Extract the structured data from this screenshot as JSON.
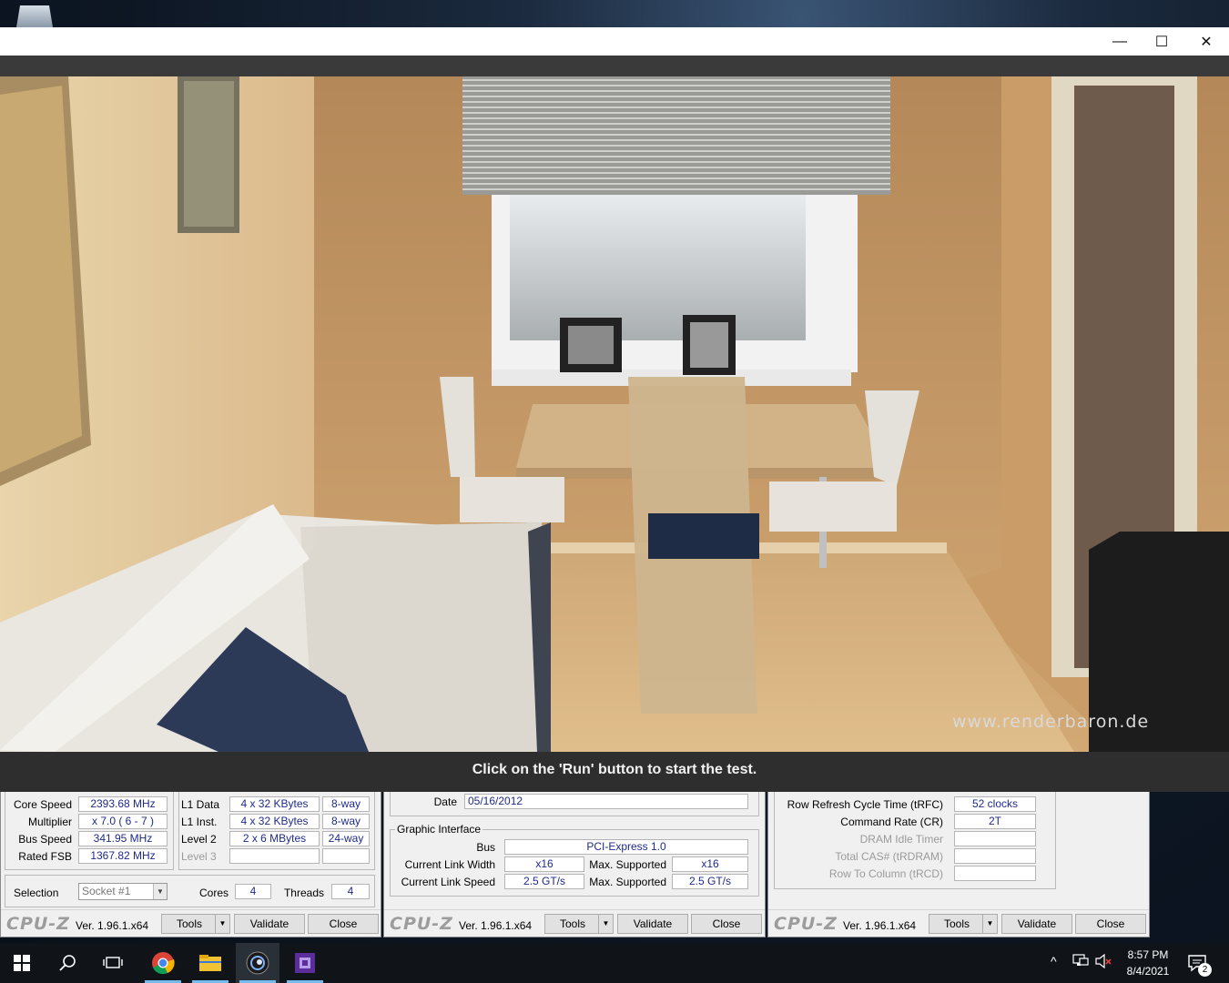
{
  "viewer": {
    "status_message": "Click on the 'Run' button to start the test.",
    "watermark": "www.renderbaron.de",
    "window_buttons": {
      "minimize": "—",
      "maximize": "☐",
      "close": "✕"
    }
  },
  "cpuz_cpu": {
    "core_speed_label": "Core Speed",
    "core_speed": "2393.68 MHz",
    "multiplier_label": "Multiplier",
    "multiplier": "x 7.0 ( 6 - 7 )",
    "bus_speed_label": "Bus Speed",
    "bus_speed": "341.95 MHz",
    "rated_fsb_label": "Rated FSB",
    "rated_fsb": "1367.82 MHz",
    "l1_data_label": "L1 Data",
    "l1_data": "4 x 32 KBytes",
    "l1_data_way": "8-way",
    "l1_inst_label": "L1 Inst.",
    "l1_inst": "4 x 32 KBytes",
    "l1_inst_way": "8-way",
    "level2_label": "Level 2",
    "level2": "2 x 6 MBytes",
    "level2_way": "24-way",
    "level3_label": "Level 3",
    "selection_label": "Selection",
    "selection": "Socket #1",
    "cores_label": "Cores",
    "cores": "4",
    "threads_label": "Threads",
    "threads": "4"
  },
  "cpuz_mainboard": {
    "date_label": "Date",
    "date": "05/16/2012",
    "graphic_interface_label": "Graphic Interface",
    "bus_label": "Bus",
    "bus": "PCI-Express 1.0",
    "link_width_label": "Current Link Width",
    "link_width": "x16",
    "link_width_max_label": "Max. Supported",
    "link_width_max": "x16",
    "link_speed_label": "Current Link Speed",
    "link_speed": "2.5 GT/s",
    "link_speed_max_label": "Max. Supported",
    "link_speed_max": "2.5 GT/s"
  },
  "cpuz_memory": {
    "trfc_label": "Row Refresh Cycle Time (tRFC)",
    "trfc": "52 clocks",
    "cr_label": "Command Rate (CR)",
    "cr": "2T",
    "idle_label": "DRAM Idle Timer",
    "trdram_label": "Total CAS# (tRDRAM)",
    "trcd_label": "Row To Column (tRCD)"
  },
  "cpuz_footer": {
    "logo": "CPU-Z",
    "version": "Ver. 1.96.1.x64",
    "tools": "Tools",
    "validate": "Validate",
    "close": "Close",
    "dropdown_arrow": "▼"
  },
  "taskbar": {
    "time": "8:57 PM",
    "date": "8/4/2021",
    "notification_count": "2",
    "icons": [
      "windows-start-icon",
      "search-icon",
      "task-view-icon",
      "chrome-icon",
      "file-explorer-icon",
      "benchmark-app-icon",
      "cpuz-app-icon"
    ]
  },
  "colors": {
    "cpuz_value": "#1e2a8c",
    "taskbar": "#101418",
    "status_bar": "#2e2e2e"
  }
}
